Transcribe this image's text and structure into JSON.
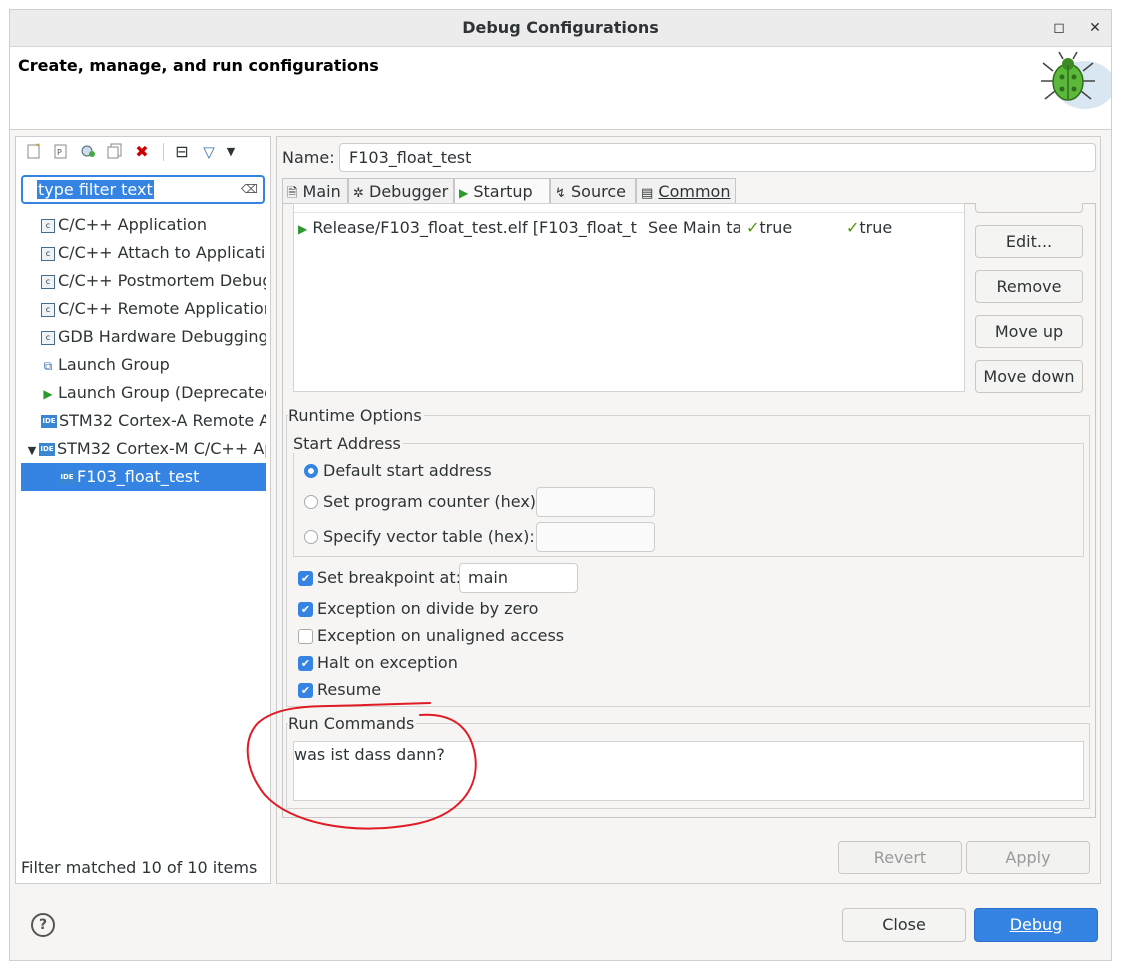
{
  "window": {
    "title": "Debug Configurations",
    "maximize_glyph": "◻",
    "close_glyph": "✕"
  },
  "header": {
    "title": "Create, manage, and run configurations",
    "icon": "bug-icon"
  },
  "left_toolbar": {
    "icons": [
      "new-configuration-icon",
      "new-prototype-icon",
      "export-icon",
      "duplicate-icon",
      "delete-icon",
      "collapse-all-icon",
      "filter-icon",
      "dropdown-arrow-icon"
    ],
    "delete_glyph": "✖",
    "collapse_glyph": "⊟",
    "filter_glyph": "▽",
    "dropdown_glyph": "▼"
  },
  "filter": {
    "value": "type filter text",
    "clear_glyph": "⌫"
  },
  "tree": {
    "items": [
      {
        "label": "C/C++ Application",
        "icon": "c-icon"
      },
      {
        "label": "C/C++ Attach to Applicatio",
        "icon": "c-icon"
      },
      {
        "label": "C/C++ Postmortem Debug",
        "icon": "c-icon"
      },
      {
        "label": "C/C++ Remote Application",
        "icon": "c-icon"
      },
      {
        "label": "GDB Hardware Debugging",
        "icon": "c-icon"
      },
      {
        "label": "Launch Group",
        "icon": "launch-group-icon"
      },
      {
        "label": "Launch Group (Deprecated",
        "icon": "play-icon"
      },
      {
        "label": "STM32 Cortex-A Remote A",
        "icon": "ide-icon"
      },
      {
        "label": "STM32 Cortex-M C/C++ Ap",
        "icon": "ide-icon",
        "expanded": true
      },
      {
        "label": "F103_float_test",
        "icon": "ide-icon",
        "selected": true
      }
    ],
    "c_glyph": "c",
    "ide_glyph": "IDE",
    "expand_glyph": "▼",
    "play_glyph": "▶",
    "launch_glyph": "⧉"
  },
  "filter_status": "Filter matched 10 of 10 items",
  "config": {
    "name_label": "Name:",
    "name_value": "F103_float_test"
  },
  "tabs": [
    {
      "label": "Main",
      "glyph": "🗎"
    },
    {
      "label": "Debugger",
      "glyph": "✲"
    },
    {
      "label": "Startup",
      "glyph": "▶",
      "active": true
    },
    {
      "label": "Source",
      "glyph": "↯"
    },
    {
      "label": "Common",
      "glyph": "▤"
    }
  ],
  "load_table": {
    "row": {
      "file": "Release/F103_float_test.elf [F103_float_t",
      "build": "See Main tal",
      "col3": "true",
      "col4": "true"
    },
    "check_glyph": "✓",
    "play_glyph": "▶"
  },
  "side_buttons": {
    "edit": "Edit...",
    "remove": "Remove",
    "move_up": "Move up",
    "move_down": "Move down"
  },
  "runtime_options": {
    "label": "Runtime Options",
    "start_address": {
      "label": "Start Address",
      "options": [
        {
          "label": "Default start address",
          "selected": true
        },
        {
          "label": "Set program counter (hex):",
          "selected": false
        },
        {
          "label": "Specify vector table (hex):",
          "selected": false
        }
      ]
    },
    "breakpoint": {
      "label": "Set breakpoint at:",
      "checked": true,
      "value": "main"
    },
    "checks": [
      {
        "label": "Exception on divide by zero",
        "checked": true
      },
      {
        "label": "Exception on unaligned access",
        "checked": false
      },
      {
        "label": "Halt on exception",
        "checked": true
      },
      {
        "label": "Resume",
        "checked": true
      }
    ],
    "check_glyph": "✔"
  },
  "run_commands": {
    "label": "Run Commands",
    "value": "was ist dass dann?"
  },
  "annotation": {
    "color": "#e01b24"
  },
  "footer": {
    "revert": "Revert",
    "apply": "Apply",
    "close": "Close",
    "debug": "Debug",
    "help_glyph": "?"
  },
  "colors": {
    "accent": "#3584e4",
    "annotation": "#e01b24"
  }
}
